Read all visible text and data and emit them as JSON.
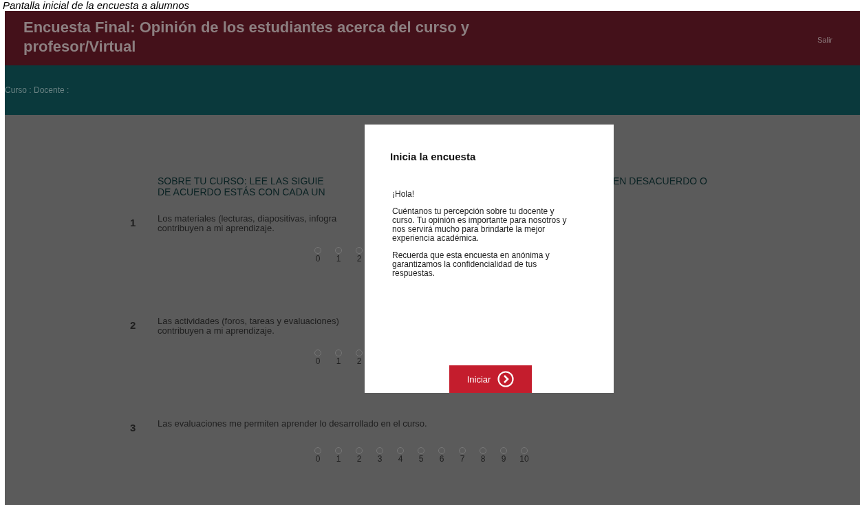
{
  "caption": "Pantalla inicial de la encuesta a alumnos",
  "header": {
    "title": "Encuesta Final: Opinión de los estudiantes acerca del curso y profesor/Virtual",
    "logout": "Salir"
  },
  "subheader": {
    "text": "Curso : Docente :"
  },
  "section": {
    "heading_left": [
      "SOBRE TU CURSO: LEE LAS SIGUIE",
      "DE ACUERDO ESTÁS CON CADA UN"
    ],
    "heading_right": "EN DESACUERDO O"
  },
  "questions": [
    {
      "number": "1",
      "text": [
        "Los materiales (lecturas, diapositivas, infogra",
        "contribuyen a mi aprendizaje."
      ],
      "options": [
        {
          "label": "0",
          "selected": false
        },
        {
          "label": "1",
          "selected": false
        },
        {
          "label": "2",
          "selected": false
        }
      ]
    },
    {
      "number": "2",
      "text": [
        "Las actividades (foros, tareas y evaluaciones)",
        "contribuyen a mi aprendizaje."
      ],
      "options": [
        {
          "label": "0",
          "selected": false
        },
        {
          "label": "1",
          "selected": false
        },
        {
          "label": "2",
          "selected": false
        }
      ]
    },
    {
      "number": "3",
      "text": [
        "Las evaluaciones me permiten aprender lo desarrollado en el curso."
      ],
      "options": [
        {
          "label": "0",
          "selected": false
        },
        {
          "label": "1",
          "selected": false
        },
        {
          "label": "2",
          "selected": false
        },
        {
          "label": "3",
          "selected": false
        },
        {
          "label": "4",
          "selected": false
        },
        {
          "label": "5",
          "selected": false
        },
        {
          "label": "6",
          "selected": false
        },
        {
          "label": "7",
          "selected": false
        },
        {
          "label": "8",
          "selected": false
        },
        {
          "label": "9",
          "selected": false
        },
        {
          "label": "10",
          "selected": false
        }
      ]
    }
  ],
  "modal": {
    "title": "Inicia la encuesta",
    "paragraphs": [
      "¡Hola!",
      "Cuéntanos tu percepción sobre tu docente y curso. Tu opinión es importante para nosotros y nos servirá mucho para brindarte la mejor experiencia académica.",
      "Recuerda que esta encuesta en anónima y garantizamos la confidencialidad de tus respuestas."
    ],
    "button": "Iniciar"
  }
}
